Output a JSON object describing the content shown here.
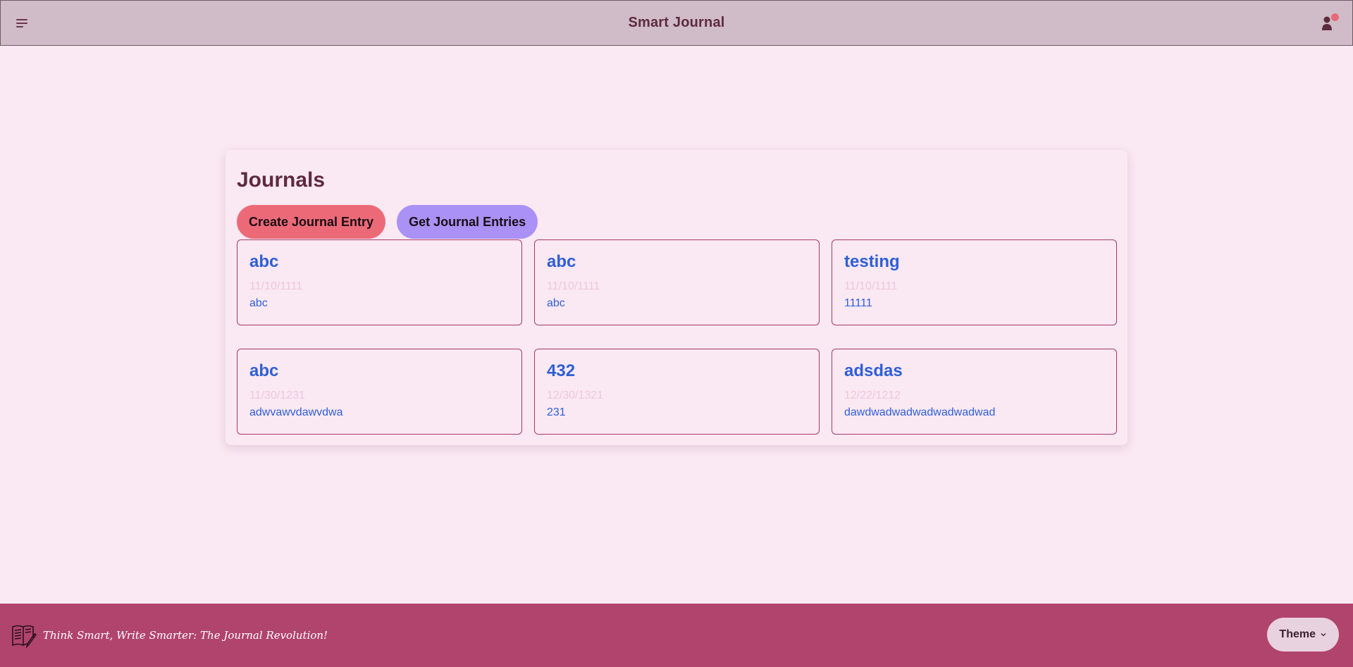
{
  "header": {
    "title": "Smart Journal",
    "menu_icon": "hamburger-menu-icon",
    "user_icon": "user-icon",
    "notification_color": "#e8697a"
  },
  "main": {
    "heading": "Journals",
    "create_button": "Create Journal Entry",
    "get_button": "Get Journal Entries",
    "entries": [
      {
        "title": "abc",
        "date": "11/10/1111",
        "body": "abc"
      },
      {
        "title": "abc",
        "date": "11/10/1111",
        "body": "abc"
      },
      {
        "title": "testing",
        "date": "11/10/1111",
        "body": "11111"
      },
      {
        "title": "abc",
        "date": "11/30/1231",
        "body": "adwvawvdawvdwa"
      },
      {
        "title": "432",
        "date": "12/30/1321",
        "body": "231"
      },
      {
        "title": "adsdas",
        "date": "12/22/1212",
        "body": "dawdwadwadwadwadwadwad"
      }
    ]
  },
  "footer": {
    "logo_icon": "journal-writing-icon",
    "tagline": "Think Smart, Write Smarter: The Journal Revolution!",
    "theme_button": "Theme",
    "theme_icon": "chevron-down-icon"
  },
  "colors": {
    "background": "#fae8f3",
    "navbar": "#cfbcc8",
    "footer": "#b0446d",
    "create_button": "#ec6a78",
    "get_button": "#a991f5",
    "entry_accent": "#2f5fd7"
  }
}
